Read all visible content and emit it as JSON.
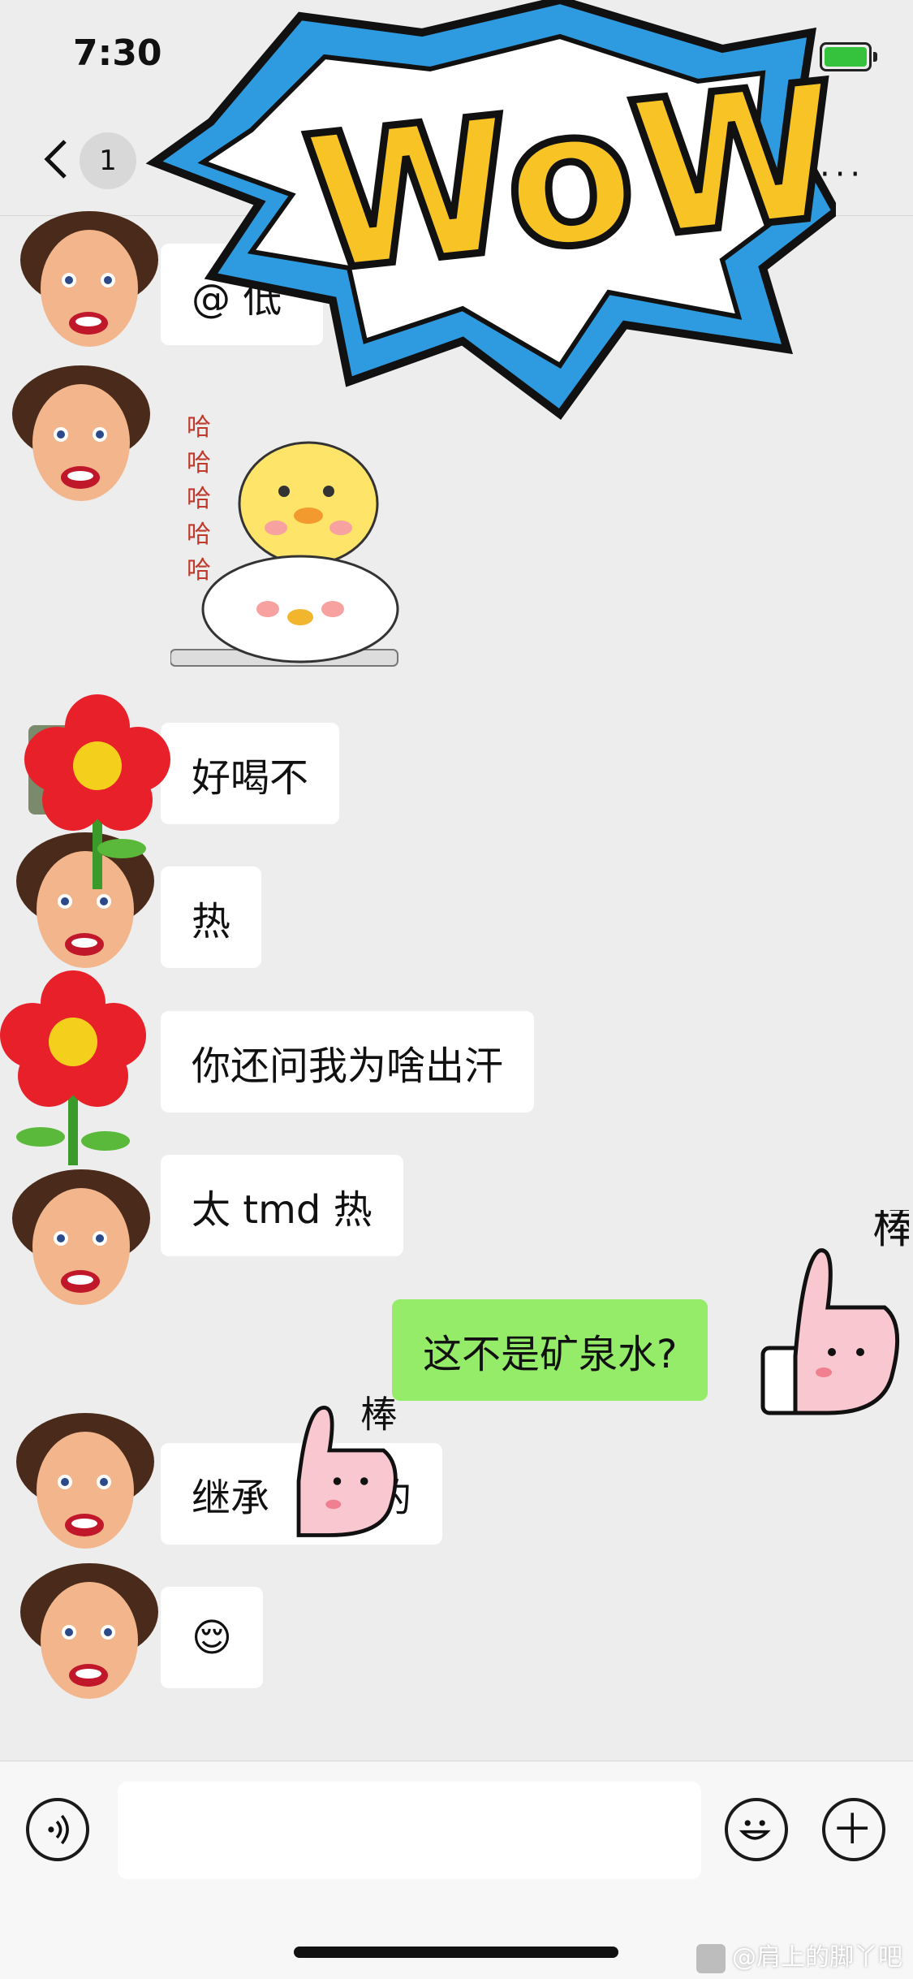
{
  "status_bar": {
    "time": "7:30"
  },
  "nav": {
    "unread_count": "1",
    "more": "···"
  },
  "chat": {
    "partial_first_message": "@ 低",
    "haha_sticker_text": "哈哈哈哈哈",
    "messages": [
      {
        "from": "other",
        "text": "好喝不"
      },
      {
        "from": "other",
        "text": "热"
      },
      {
        "from": "other",
        "text": "你还问我为啥出汗"
      },
      {
        "from": "other",
        "text": "太 tmd 热"
      },
      {
        "from": "me",
        "text": "这不是矿泉水?"
      },
      {
        "from": "other",
        "text": "继承",
        "text_after_sticker": "的"
      },
      {
        "from": "other",
        "text": "😌"
      }
    ]
  },
  "stickers": {
    "wow_text": "WoW!",
    "thumb_text": "棒"
  },
  "input_bar": {
    "placeholder": ""
  },
  "watermark": {
    "text": "@肩上的脚丫吧"
  },
  "colors": {
    "bubble_mine": "#95ec69",
    "bubble_other": "#ffffff",
    "background": "#ededed"
  }
}
